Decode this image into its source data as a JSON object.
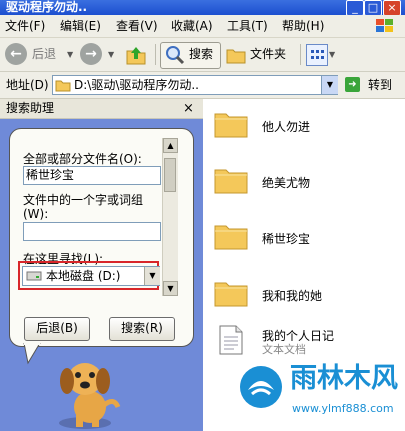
{
  "window": {
    "title": "驱动程序勿动..",
    "controls": [
      "_",
      "□",
      "×"
    ]
  },
  "menu": [
    "文件(F)",
    "编辑(E)",
    "查看(V)",
    "收藏(A)",
    "工具(T)",
    "帮助(H)"
  ],
  "toolbar": {
    "back_label": "后退",
    "search_label": "搜索",
    "folders_label": "文件夹"
  },
  "address": {
    "label": "地址(D)",
    "path": "D:\\驱动\\驱动程序勿动..",
    "go_label": "转到"
  },
  "search_pane": {
    "title": "搜索助理",
    "filename_label": "全部或部分文件名(O):",
    "filename_value": "稀世珍宝",
    "phrase_label": "文件中的一个字或词组",
    "phrase_label_2": "(W):",
    "phrase_value": "",
    "lookin_label": "在这里寻找(L):",
    "lookin_value": "本地磁盘 (D:)",
    "back_button": "后退(B)",
    "search_button": "搜索(R)"
  },
  "files": [
    {
      "name": "他人勿进",
      "type": "folder"
    },
    {
      "name": "绝美尤物",
      "type": "folder"
    },
    {
      "name": "稀世珍宝",
      "type": "folder"
    },
    {
      "name": "我和我的她",
      "type": "folder"
    },
    {
      "name": "我的个人日记",
      "sub": "文本文档",
      "type": "text"
    }
  ],
  "watermark": {
    "brand": "雨林木风",
    "url": "www.ylmf888.com"
  },
  "colors": {
    "title_bar": "#1c4fcf",
    "pane_bg": "#6f8ad8",
    "folder": "#f4c85a",
    "highlight_box": "#d8262a",
    "watermark": "#1a8fd4"
  }
}
